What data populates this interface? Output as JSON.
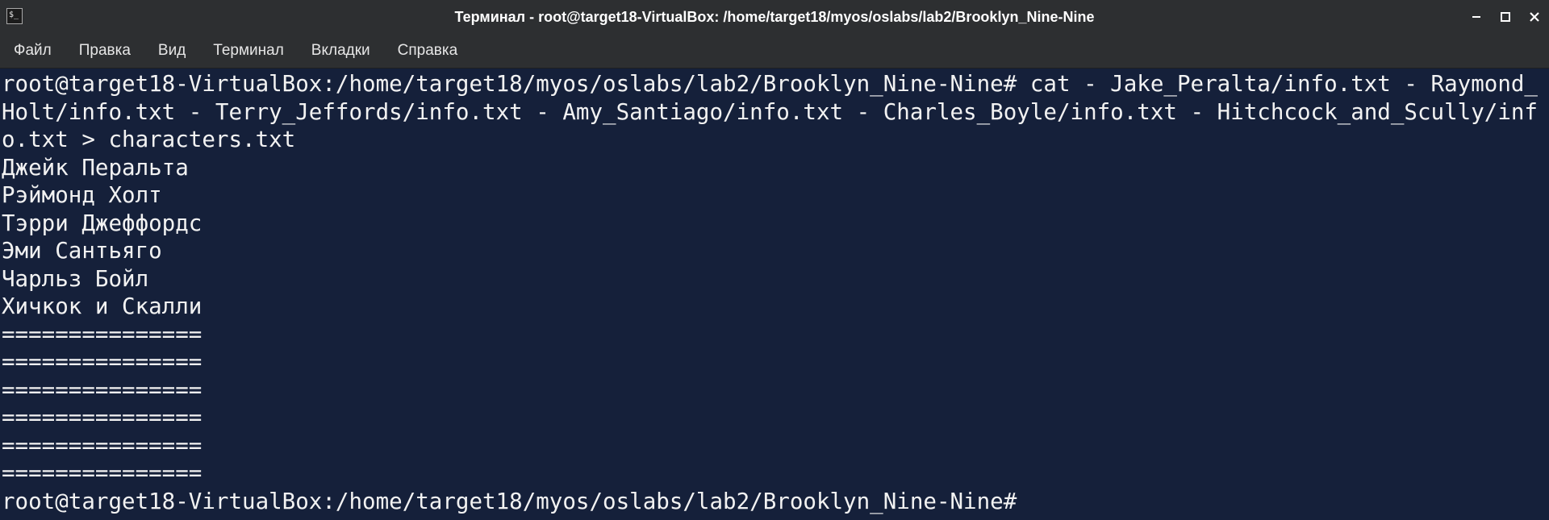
{
  "window": {
    "title": "Терминал - root@target18-VirtualBox: /home/target18/myos/oslabs/lab2/Brooklyn_Nine-Nine",
    "icon": "terminal-icon",
    "icon_glyph": "$_",
    "controls": [
      "minimize-icon",
      "maximize-icon",
      "close-icon"
    ]
  },
  "menu": {
    "items": [
      "Файл",
      "Правка",
      "Вид",
      "Терминал",
      "Вкладки",
      "Справка"
    ]
  },
  "terminal": {
    "lines": [
      "root@target18-VirtualBox:/home/target18/myos/oslabs/lab2/Brooklyn_Nine-Nine# cat - Jake_Peralta/info.txt - Raymond_",
      "Holt/info.txt - Terry_Jeffords/info.txt - Amy_Santiago/info.txt - Charles_Boyle/info.txt - Hitchcock_and_Scully/inf",
      "o.txt > characters.txt",
      "Джейк Перальта",
      "Рэймонд Холт",
      "Тэрри Джеффордс",
      "Эми Сантьяго",
      "Чарльз Бойл",
      "Хичкок и Скалли",
      "===============",
      "===============",
      "===============",
      "===============",
      "===============",
      "===============",
      "root@target18-VirtualBox:/home/target18/myos/oslabs/lab2/Brooklyn_Nine-Nine# "
    ]
  },
  "colors": {
    "terminal_background": "#15203a",
    "terminal_foreground": "#f2f2f2",
    "titlebar_background": "#2d2f31"
  }
}
